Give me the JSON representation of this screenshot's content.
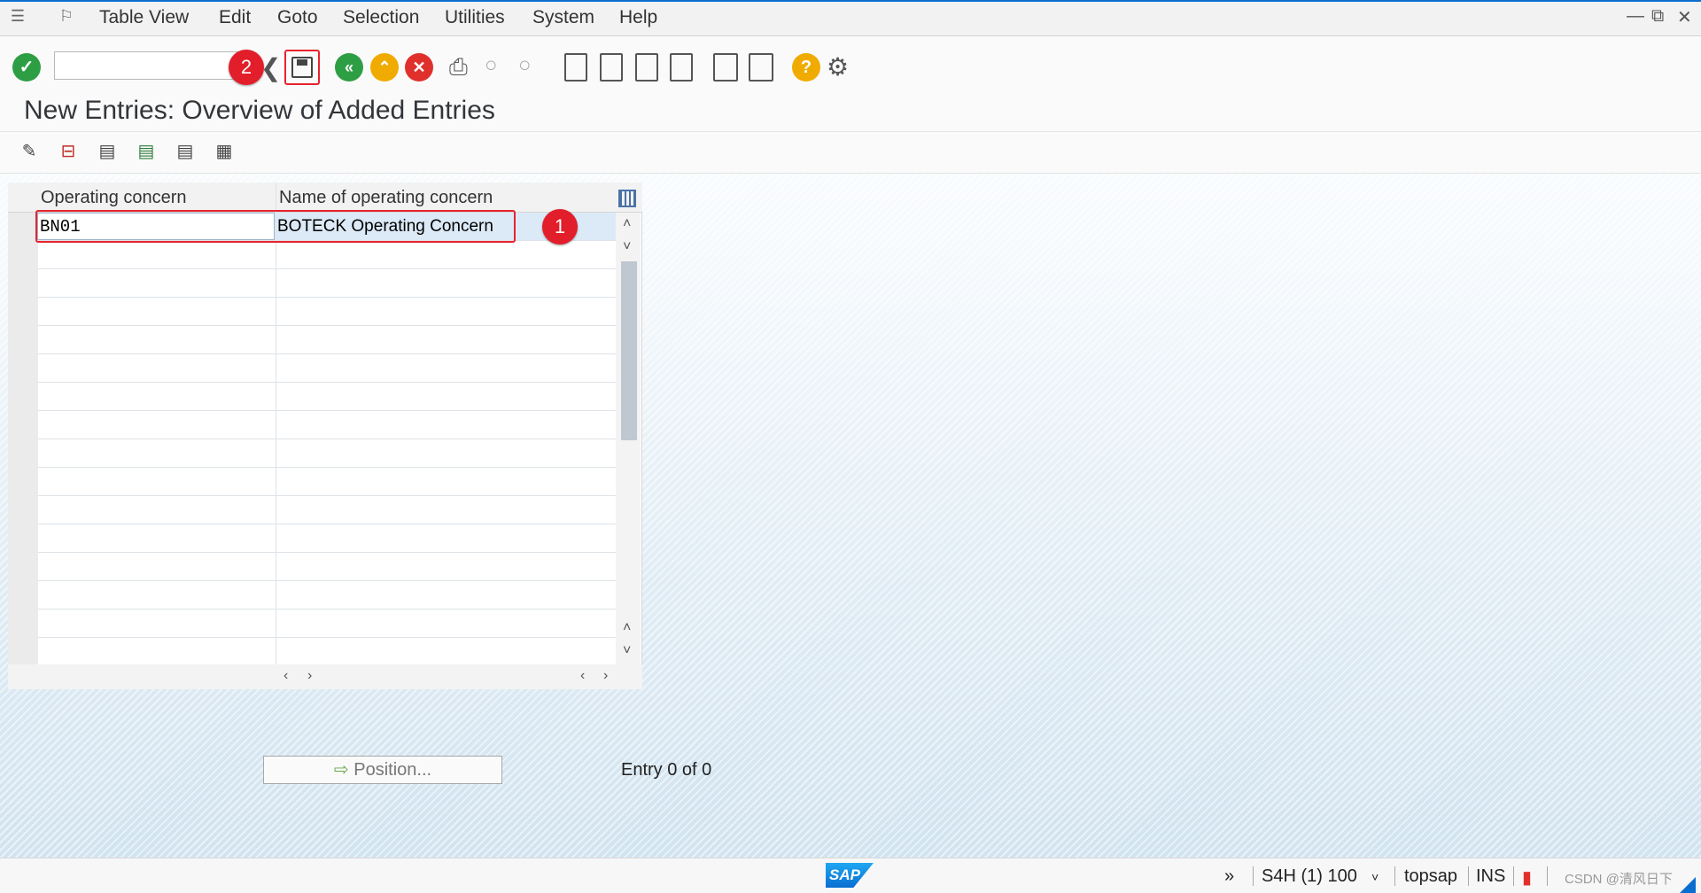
{
  "menubar": {
    "items": [
      "Table View",
      "Edit",
      "Goto",
      "Selection",
      "Utilities",
      "System",
      "Help"
    ]
  },
  "toolbar": {
    "command_value": "",
    "icons": [
      "enter-icon",
      "command-field",
      "back-history-icon",
      "save-icon",
      "back-icon",
      "exit-icon",
      "cancel-icon",
      "print-icon",
      "find-icon",
      "find-next-icon",
      "first-page-icon",
      "previous-page-icon",
      "next-page-icon",
      "last-page-icon",
      "create-session-icon",
      "shortcut-icon",
      "help-icon",
      "settings-icon"
    ]
  },
  "page_title": "New Entries: Overview of Added Entries",
  "app_toolbar": {
    "icons": [
      "change-display-icon",
      "delete-row-icon",
      "select-all-icon",
      "select-block-icon",
      "deselect-all-icon",
      "view-list-icon"
    ]
  },
  "table": {
    "columns": [
      "Operating concern",
      "Name of operating concern"
    ],
    "rows": [
      {
        "code": "BN01",
        "name": "BOTECK Operating Concern"
      }
    ]
  },
  "annotations": {
    "badge_1": "1",
    "badge_2": "2"
  },
  "position_button": "Position...",
  "entry_text": "Entry 0 of 0",
  "statusbar": {
    "logo": "SAP",
    "system": "S4H (1) 100",
    "server": "topsap",
    "mode": "INS",
    "watermark": "CSDN @清风日下"
  },
  "colors": {
    "accent": "#0a6ed1",
    "badge": "#e21e2a",
    "highlight": "#e8232e",
    "enter_green": "#2e9e44",
    "cancel_red": "#e0302c",
    "back_orange": "#f0ab00"
  }
}
